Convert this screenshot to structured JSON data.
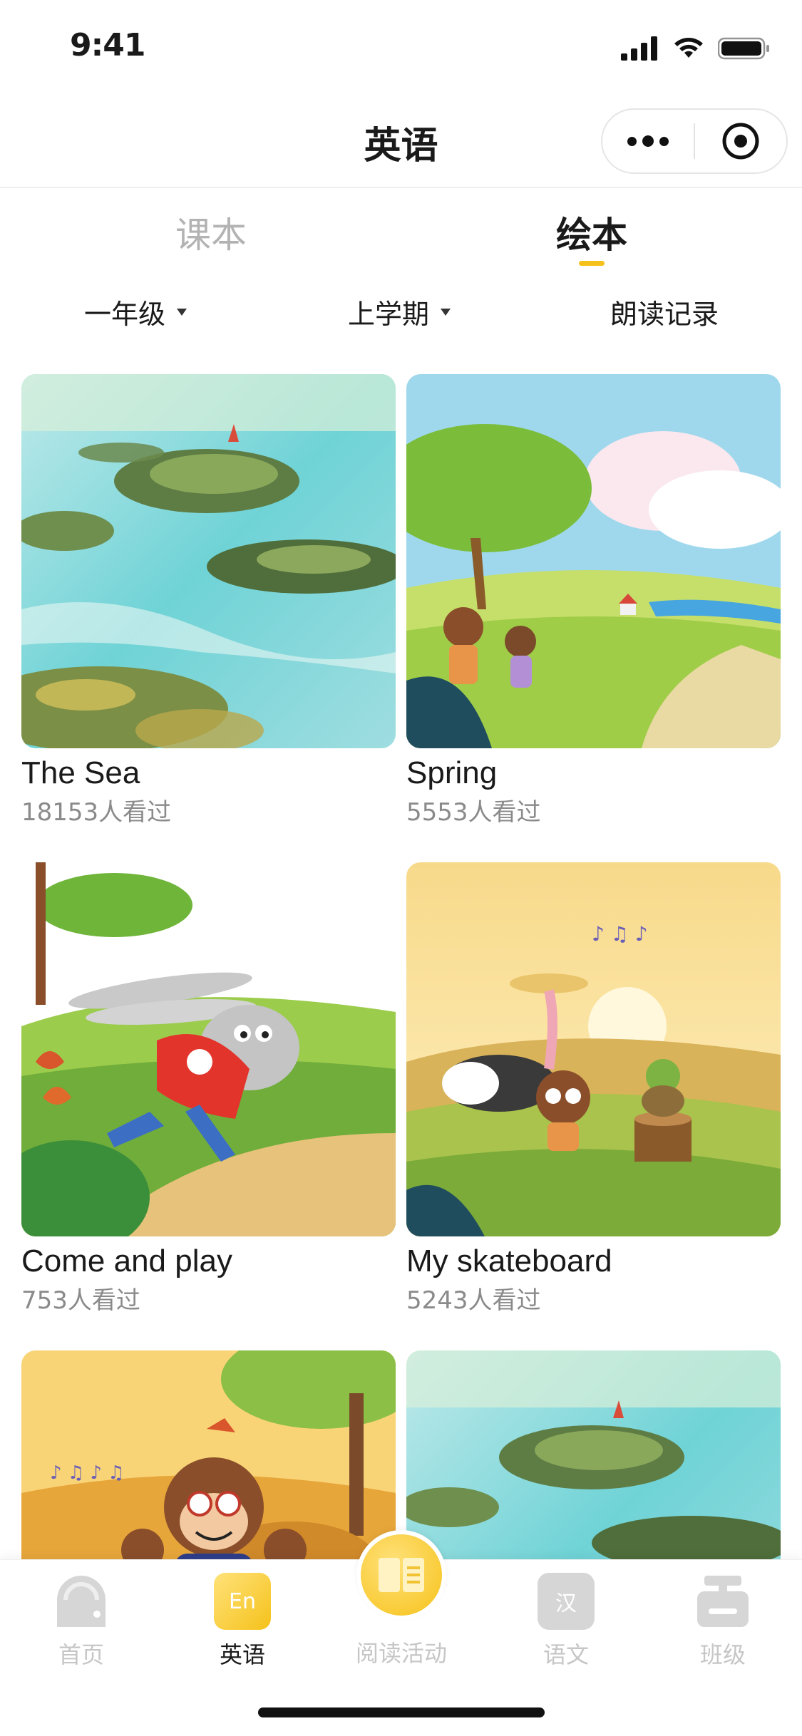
{
  "status_bar": {
    "time": "9:41",
    "icons": [
      "signal-icon",
      "wifi-icon",
      "battery-icon"
    ]
  },
  "nav": {
    "title": "英语",
    "capsule_icons": [
      "more-icon",
      "close-target-icon"
    ]
  },
  "tabs": [
    {
      "label": "课本",
      "active": false
    },
    {
      "label": "绘本",
      "active": true
    }
  ],
  "filters": {
    "grade": "一年级",
    "term": "上学期",
    "record": "朗读记录"
  },
  "books": [
    {
      "title": "The Sea",
      "views": "18153人看过",
      "cover": "sea-cover"
    },
    {
      "title": "Spring",
      "views": "5553人看过",
      "cover": "spring-cover"
    },
    {
      "title": "Come and play",
      "views": "753人看过",
      "cover": "rabbit-cover"
    },
    {
      "title": "My skateboard",
      "views": "5243人看过",
      "cover": "skateboard-cover"
    },
    {
      "title": "",
      "views": "",
      "cover": "monkey-cover"
    },
    {
      "title": "",
      "views": "",
      "cover": "sea-cover"
    }
  ],
  "tabbar": {
    "items": [
      {
        "label": "首页",
        "icon": "home-icon",
        "active": false
      },
      {
        "label": "英语",
        "icon": "english-icon",
        "active": true,
        "icon_text": "En"
      },
      {
        "label": "阅读活动",
        "icon": "book-icon",
        "active": false
      },
      {
        "label": "语文",
        "icon": "chinese-icon",
        "active": false,
        "icon_text": "汉"
      },
      {
        "label": "班级",
        "icon": "class-icon",
        "active": false
      }
    ]
  },
  "colors": {
    "accent": "#f5c21b",
    "inactive": "#c6c6c6",
    "text": "#1a1a1a",
    "subtext": "#8a8a8a"
  }
}
